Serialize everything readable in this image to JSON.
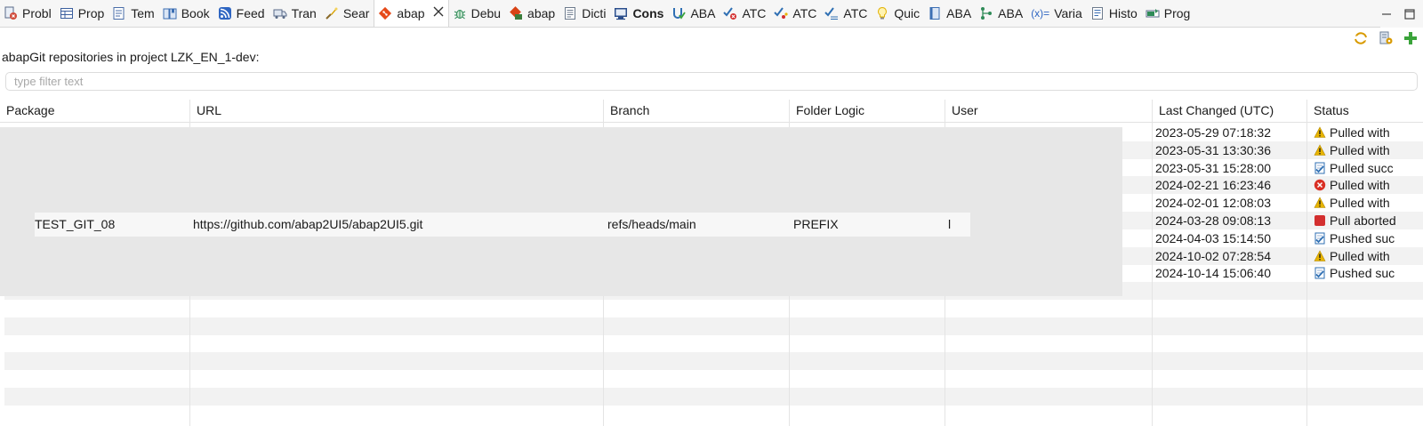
{
  "tabs": [
    {
      "label": "Probl",
      "icon": "problems-icon",
      "color": "#d04a3a"
    },
    {
      "label": "Prop",
      "icon": "properties-icon",
      "color": "#3b5f9e"
    },
    {
      "label": "Tem",
      "icon": "templates-icon",
      "color": "#4a6da8"
    },
    {
      "label": "Book",
      "icon": "bookmarks-icon",
      "color": "#3c6fb3"
    },
    {
      "label": "Feed",
      "icon": "feed-icon",
      "color": "#2f66c2"
    },
    {
      "label": "Tran",
      "icon": "transport-icon",
      "color": "#5a6b88"
    },
    {
      "label": "Sear",
      "icon": "search-icon",
      "color": "#d9a300"
    },
    {
      "label": "abap",
      "icon": "abapgit-icon",
      "color": "#e64a19",
      "active": true,
      "closable": true
    },
    {
      "label": "Debu",
      "icon": "debug-icon",
      "color": "#2e8b57"
    },
    {
      "label": "abap",
      "icon": "abapgit-staging-icon",
      "color": "#d84315"
    },
    {
      "label": "Dicti",
      "icon": "dictionary-icon",
      "color": "#6d7b8d"
    },
    {
      "label": "Cons",
      "icon": "console-icon",
      "color": "#2b4e8c",
      "bold": true
    },
    {
      "label": "ABA",
      "icon": "abap-unit-icon",
      "color": "#2f6fb3"
    },
    {
      "label": "ATC",
      "icon": "atc-problems-icon",
      "color": "#2f6fb3"
    },
    {
      "label": "ATC",
      "icon": "atc-results-icon",
      "color": "#2f6fb3"
    },
    {
      "label": "ATC",
      "icon": "atc-exemptions-icon",
      "color": "#2f6fb3"
    },
    {
      "label": "Quic",
      "icon": "quick-assist-icon",
      "color": "#e2b100"
    },
    {
      "label": "ABA",
      "icon": "abap-doc-icon",
      "color": "#3c6fb3"
    },
    {
      "label": "ABA",
      "icon": "abap-type-hierarchy-icon",
      "color": "#2e8b57"
    },
    {
      "label": "Varia",
      "icon": "variables-icon",
      "color": "#2f66c2",
      "glyph": "(x)="
    },
    {
      "label": "Histo",
      "icon": "history-icon",
      "color": "#6d7b8d"
    },
    {
      "label": "Prog",
      "icon": "progress-icon",
      "color": "#2e8b57"
    }
  ],
  "window": {
    "minimize_icon": "minimize-icon",
    "maximize_icon": "maximize-icon"
  },
  "toolbar": {
    "refresh_icon": "refresh-icon",
    "config_icon": "configure-icon",
    "add_icon": "add-icon"
  },
  "caption": "abapGit repositories in project LZK_EN_1-dev:",
  "filter": {
    "placeholder": "type filter text",
    "value": ""
  },
  "columns": [
    "Package",
    "URL",
    "Branch",
    "Folder Logic",
    "User",
    "Last Changed (UTC)",
    "Status"
  ],
  "rows": [
    {
      "last_changed": "2023-05-29 07:18:32",
      "status": "Pulled with",
      "status_icon": "warning-icon"
    },
    {
      "last_changed": "2023-05-31 13:30:36",
      "status": "Pulled with",
      "status_icon": "warning-icon"
    },
    {
      "last_changed": "2023-05-31 15:28:00",
      "status": "Pulled succ",
      "status_icon": "success-checklist-icon"
    },
    {
      "last_changed": "2024-02-21 16:23:46",
      "status": "Pulled with",
      "status_icon": "error-icon"
    },
    {
      "last_changed": "2024-02-01 12:08:03",
      "status": "Pulled with",
      "status_icon": "warning-icon"
    },
    {
      "last_changed": "2024-03-28 09:08:13",
      "status": "Pull aborted",
      "status_icon": "stop-icon"
    },
    {
      "last_changed": "2024-04-03 15:14:50",
      "status": "Pushed suc",
      "status_icon": "success-checklist-icon"
    },
    {
      "last_changed": "2024-10-02 07:28:54",
      "status": "Pulled with",
      "status_icon": "warning-icon"
    },
    {
      "last_changed": "2024-10-14 15:06:40",
      "status": "Pushed suc",
      "status_icon": "success-checklist-icon"
    }
  ],
  "ghost_row": {
    "package": "TEST_GIT_08",
    "url": "https://github.com/abap2UI5/abap2UI5.git",
    "branch": "refs/heads/main",
    "folder_logic": "PREFIX",
    "user": "l"
  },
  "colors": {
    "row_stripe": "#f2f2f2",
    "overlay": "#e7e7e7",
    "warning": "#e8b400",
    "error": "#d93025",
    "stop": "#d32f2f",
    "success": "#2f6fb3"
  }
}
